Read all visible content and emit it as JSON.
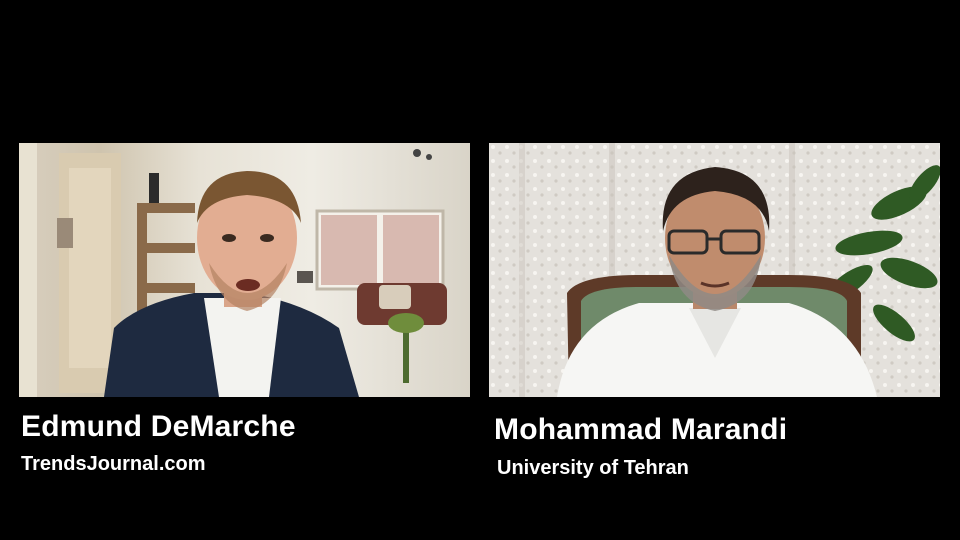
{
  "participants": [
    {
      "name": "Edmund DeMarche",
      "affiliation": "TrendsJournal.com"
    },
    {
      "name": "Mohammad Marandi",
      "affiliation": "University of Tehran"
    }
  ],
  "colors": {
    "background": "#000000",
    "label_text": "#ffffff"
  }
}
